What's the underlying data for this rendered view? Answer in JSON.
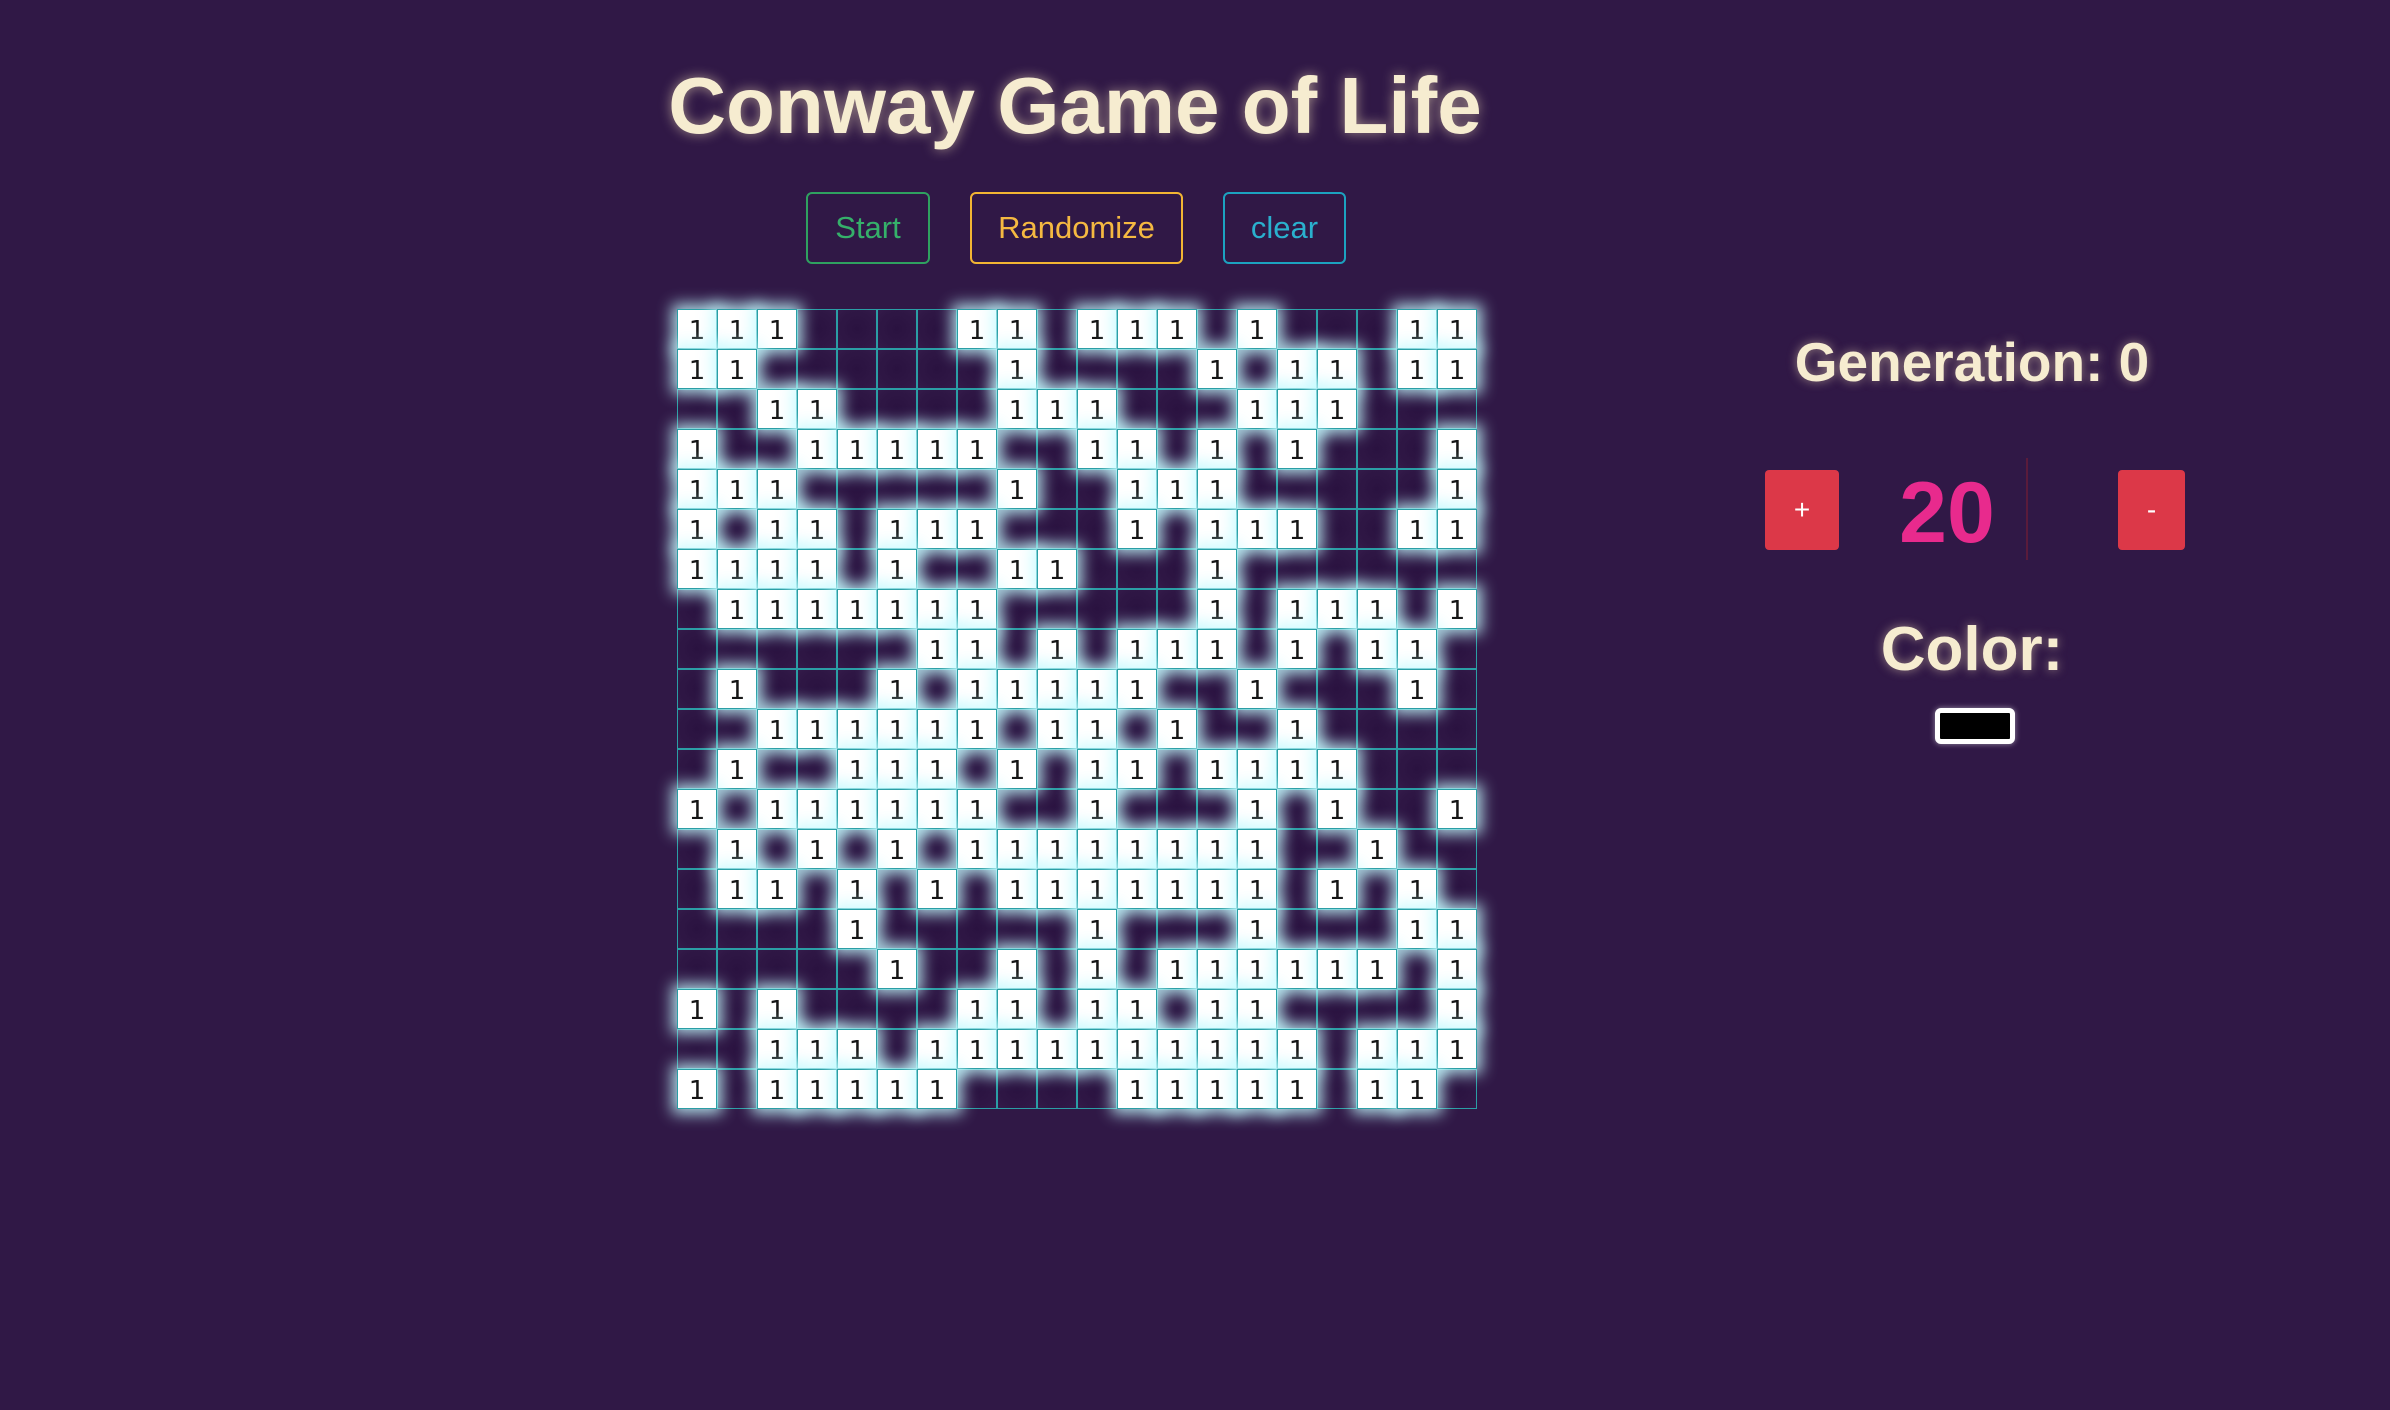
{
  "header": {
    "title": "Conway Game of Life"
  },
  "controls": {
    "start_label": "Start",
    "randomize_label": "Randomize",
    "clear_label": "clear"
  },
  "board": {
    "alive_text": "1",
    "rows": [
      "11100001101110100011",
      "11000000100001011011",
      "00110000111000111000",
      "10011111001101010001",
      "11100000100111000001",
      "10110111000101110011",
      "11110100110001000000",
      "01111111000001011101",
      "00000011010111010110",
      "01000101111100100010",
      "00111111011010010000",
      "01001110101101111000",
      "10111111001000101001",
      "01010101111111100100",
      "01101010111111101010",
      "00001000001000100011",
      "00000100101011111101",
      "10100001101101100001",
      "00111011111111110111",
      "10111110000111110110"
    ]
  },
  "stats": {
    "generation_text": "Generation: 0",
    "size_value": "20",
    "plus_label": "+",
    "minus_label": "-"
  },
  "color": {
    "label": "Color:",
    "value": "#000000"
  },
  "colors": {
    "background": "#301846",
    "alive_cell": "#ffffff",
    "grid_line": "#2b9ea5",
    "start": "#35b06a",
    "randomize": "#f5b941",
    "clear": "#2ab0ce",
    "size_button": "#dc3848",
    "size_value": "#e82a8d"
  }
}
